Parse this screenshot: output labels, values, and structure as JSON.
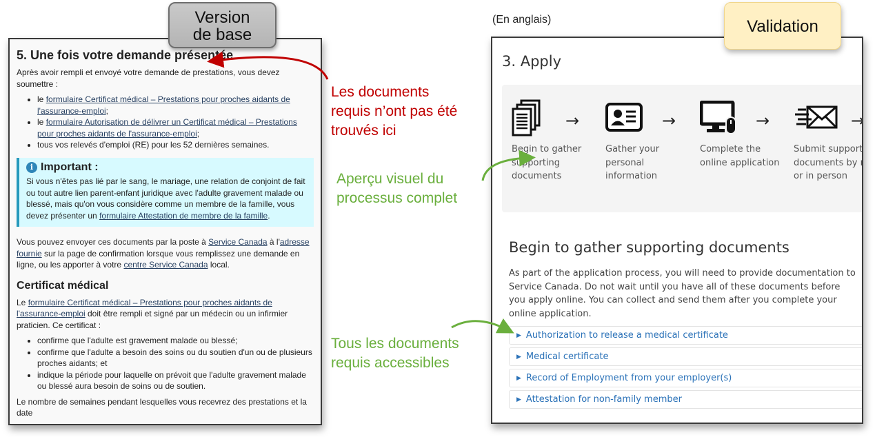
{
  "tags": {
    "baseline": "Version\nde base",
    "baseline_line1": "Version",
    "baseline_line2": "de base",
    "validation": "Validation"
  },
  "colors": {
    "annotation_negative": "#c00000",
    "annotation_positive": "#6aaf3d",
    "important_bg": "#d7faff",
    "important_border": "#269abc",
    "link_blue": "#2b72b8"
  },
  "left": {
    "heading": "5. Une fois votre demande présentée",
    "intro": "Après avoir rempli et envoyé votre demande de prestations, vous devez soumettre :",
    "list": [
      {
        "prefix": "le ",
        "link": "formulaire Certificat médical – Prestations pour proches aidants de l'assurance-emploi",
        "suffix": ";"
      },
      {
        "prefix": "le ",
        "link": "formulaire Autorisation de délivrer un Certificat médical – Prestations pour proches aidants de l'assurance-emploi",
        "suffix": ";"
      },
      {
        "prefix": "tous vos relevés d'emploi (RE) pour les 52 dernières semaines.",
        "link": "",
        "suffix": ""
      }
    ],
    "important": {
      "icon": "info-icon",
      "title": "Important :",
      "text": "Si vous n'êtes pas lié par le sang, le mariage, une relation de conjoint de fait ou tout autre lien parent-enfant juridique avec l'adulte gravement malade ou blessé, mais qu'on vous considère comme un membre de la famille, vous devez présenter un ",
      "link": "formulaire Attestation de membre de la famille",
      "end": "."
    },
    "mail": {
      "t1": "Vous pouvez envoyer ces documents par la poste à ",
      "l1": "Service Canada",
      "t2": " à l'",
      "l2": "adresse fournie",
      "t3": " sur la page de confirmation lorsque vous remplissez une demande en ligne, ou les apporter à votre ",
      "l3": "centre Service Canada",
      "t4": " local."
    },
    "cert_heading": "Certificat médical",
    "cert": {
      "t1": "Le ",
      "l1": "formulaire Certificat médical – Prestations pour proches aidants de l'assurance-emploi",
      "t2": " doit être rempli et signé par un médecin ou un infirmier praticien. Ce certificat :"
    },
    "cert_list": [
      "confirme que l'adulte est gravement malade ou blessé;",
      "confirme que l'adulte a besoin des soins ou du soutien d'un ou de plusieurs proches aidants; et",
      "indique la période pour laquelle on prévoit que l'adulte gravement malade ou blessé aura besoin de soins ou de soutien."
    ],
    "last_line": "Le nombre de semaines pendant lesquelles vous recevrez des prestations et la date"
  },
  "annotations": {
    "not_found": [
      "Les documents",
      "requis n’ont pas été",
      "trouvés ici"
    ],
    "visual_overview": [
      "Aperçu visuel du",
      "processus complet"
    ],
    "all_docs": [
      "Tous les documents",
      "requis accessibles"
    ]
  },
  "right": {
    "language_note": "(En anglais)",
    "title": "3. Apply",
    "steps": [
      {
        "icon": "documents-icon",
        "label": "Begin to gather supporting documents"
      },
      {
        "icon": "id-card-icon",
        "label": "Gather your personal information"
      },
      {
        "icon": "computer-icon",
        "label": "Complete the online application"
      },
      {
        "icon": "mail-icon",
        "label": "Submit supporting documents by mail or in person"
      }
    ],
    "section_title": "Begin to gather supporting documents",
    "section_text": "As part of the application process, you will need to provide documentation to Service Canada. Do not wait until you have all of these documents before you apply online. You can collect and send them after you complete your online application.",
    "accordion": [
      "Authorization to release a medical certificate",
      "Medical certificate",
      "Record of Employment from your employer(s)",
      "Attestation for non-family member"
    ]
  }
}
